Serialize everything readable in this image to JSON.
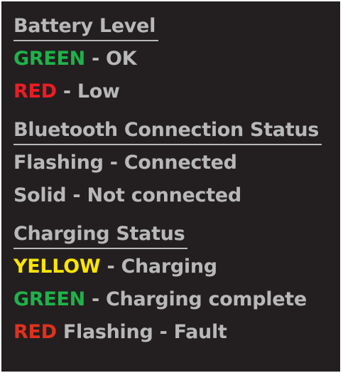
{
  "colors": {
    "background": "#231f20",
    "text": "#b8b8b8",
    "green": "#1fb24a",
    "red": "#ed1c24",
    "yellow": "#ffe500"
  },
  "battery": {
    "heading": "Battery Level",
    "items": [
      {
        "color_word": "GREEN",
        "color": "green",
        "text": " - OK"
      },
      {
        "color_word": "RED",
        "color": "red",
        "text": " - Low"
      }
    ]
  },
  "bluetooth": {
    "heading": "Bluetooth Connection Status",
    "items": [
      {
        "text": "Flashing - Connected"
      },
      {
        "text": "Solid - Not connected"
      }
    ]
  },
  "charging": {
    "heading": "Charging Status",
    "items": [
      {
        "color_word": "YELLOW",
        "color": "yellow",
        "text": " - Charging"
      },
      {
        "color_word": "GREEN",
        "color": "green",
        "text": " - Charging complete"
      },
      {
        "color_word": "RED",
        "color": "red",
        "text": " Flashing - Fault"
      }
    ]
  }
}
